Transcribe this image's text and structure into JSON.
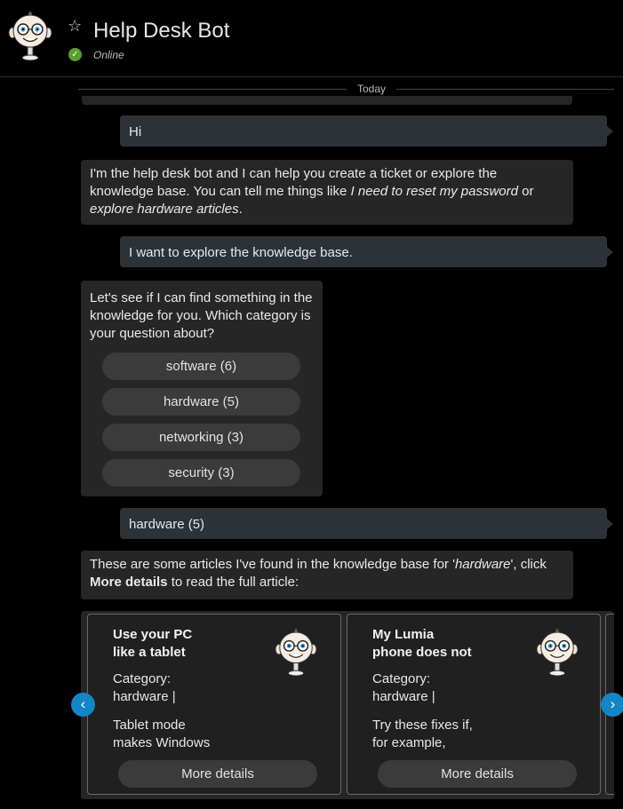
{
  "header": {
    "title": "Help Desk Bot",
    "status": "Online",
    "status_color": "#5aa02c",
    "star_icon": "star-icon"
  },
  "separator": {
    "label": "Today"
  },
  "messages": {
    "user1": "Hi",
    "bot1": {
      "part1": "I'm the help desk bot and I can help you create a ticket or explore the knowledge base. You can tell me things like ",
      "em1": "I need to reset my password",
      "part2": " or ",
      "em2": "explore hardware articles",
      "part3": "."
    },
    "user2": "I want to explore the knowledge base.",
    "bot2": "Let's see if I can find something in the knowledge for you. Which category is your question about?",
    "choices": [
      "software (6)",
      "hardware (5)",
      "networking (3)",
      "security (3)"
    ],
    "user3": "hardware (5)",
    "bot3": {
      "part1": "These are some articles I've found in the knowledge base for '",
      "em": "hardware",
      "part2": "', click ",
      "strong": "More details",
      "part3": " to read the full article:"
    }
  },
  "cards": [
    {
      "title": "Use your PC\nlike a tablet",
      "category": "Category:\nhardware |",
      "desc": "Tablet mode\nmakes Windows",
      "button": "More details"
    },
    {
      "title": "My Lumia\nphone does not",
      "category": "Category:\nhardware |",
      "desc": "Try these fixes if,\nfor example,",
      "button": "More details"
    }
  ],
  "colors": {
    "user_bubble": "#2d3238",
    "bot_bubble": "#262626",
    "accent": "#1386c8"
  }
}
